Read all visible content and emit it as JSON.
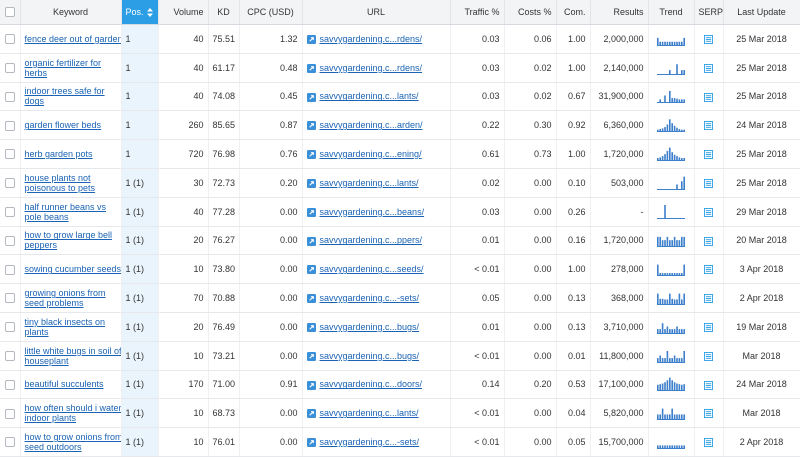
{
  "headers": {
    "keyword": "Keyword",
    "pos": "Pos.",
    "volume": "Volume",
    "kd": "KD",
    "cpc": "CPC (USD)",
    "url": "URL",
    "traffic": "Traffic %",
    "costs": "Costs %",
    "com": "Com.",
    "results": "Results",
    "trend": "Trend",
    "serp": "SERP",
    "last_update": "Last Update"
  },
  "rows": [
    {
      "keyword": "fence deer out of garden",
      "pos": "1",
      "volume": "40",
      "kd": "75.51",
      "cpc": "1.32",
      "url": "savvygardening.c...rdens/",
      "traffic": "0.03",
      "costs": "0.06",
      "com": "1.00",
      "results": "2,000,000",
      "last_update": "25 Mar 2018",
      "trend": [
        0.55,
        0.25,
        0.25,
        0.25,
        0.25,
        0.25,
        0.25,
        0.25,
        0.25,
        0.25,
        0.25,
        0.55
      ]
    },
    {
      "keyword": "organic fertilizer for herbs",
      "pos": "1",
      "volume": "40",
      "kd": "61.17",
      "cpc": "0.48",
      "url": "savvygardening.c...rdens/",
      "traffic": "0.03",
      "costs": "0.02",
      "com": "1.00",
      "results": "2,140,000",
      "last_update": "25 Mar 2018",
      "trend": [
        0,
        0,
        0,
        0,
        0,
        0.3,
        0,
        0,
        0.75,
        0,
        0.3,
        0.3
      ]
    },
    {
      "keyword": "indoor trees safe for dogs",
      "pos": "1",
      "volume": "40",
      "kd": "74.08",
      "cpc": "0.45",
      "url": "savvygardening.c...lants/",
      "traffic": "0.03",
      "costs": "0.02",
      "com": "0.67",
      "results": "31,900,000",
      "last_update": "25 Mar 2018",
      "trend": [
        0,
        0.2,
        0,
        0.5,
        0,
        0.85,
        0.3,
        0.3,
        0.25,
        0.2,
        0.2,
        0.2
      ]
    },
    {
      "keyword": "garden flower beds",
      "pos": "1",
      "volume": "260",
      "kd": "85.65",
      "cpc": "0.87",
      "url": "savvygardening.c...arden/",
      "traffic": "0.22",
      "costs": "0.30",
      "com": "0.92",
      "results": "6,360,000",
      "last_update": "24 Mar 2018",
      "trend": [
        0.1,
        0.15,
        0.2,
        0.3,
        0.5,
        0.9,
        0.6,
        0.4,
        0.25,
        0.15,
        0.1,
        0.1
      ]
    },
    {
      "keyword": "herb garden pots",
      "pos": "1",
      "volume": "720",
      "kd": "76.98",
      "cpc": "0.76",
      "url": "savvygardening.c...ening/",
      "traffic": "0.61",
      "costs": "0.73",
      "com": "1.00",
      "results": "1,720,000",
      "last_update": "25 Mar 2018",
      "trend": [
        0.15,
        0.2,
        0.3,
        0.45,
        0.7,
        0.95,
        0.6,
        0.4,
        0.3,
        0.2,
        0.15,
        0.15
      ]
    },
    {
      "keyword": "house plants not poisonous to pets",
      "pos": "1 (1)",
      "volume": "30",
      "kd": "72.73",
      "cpc": "0.20",
      "url": "savvygardening.c...lants/",
      "traffic": "0.02",
      "costs": "0.00",
      "com": "0.10",
      "results": "503,000",
      "last_update": "25 Mar 2018",
      "trend": [
        0,
        0,
        0,
        0,
        0,
        0,
        0,
        0,
        0.35,
        0,
        0.6,
        0.95
      ]
    },
    {
      "keyword": "half runner beans vs pole beans",
      "pos": "1 (1)",
      "volume": "40",
      "kd": "77.28",
      "cpc": "0.00",
      "url": "savvygardening.c...beans/",
      "traffic": "0.03",
      "costs": "0.00",
      "com": "0.26",
      "results": "-",
      "last_update": "29 Mar 2018",
      "trend": [
        0,
        0,
        0,
        1,
        0,
        0,
        0,
        0,
        0,
        0,
        0,
        0
      ]
    },
    {
      "keyword": "how to grow large bell peppers",
      "pos": "1 (1)",
      "volume": "20",
      "kd": "76.27",
      "cpc": "0.00",
      "url": "savvygardening.c...ppers/",
      "traffic": "0.01",
      "costs": "0.00",
      "com": "0.16",
      "results": "1,720,000",
      "last_update": "20 Mar 2018",
      "trend": [
        0.7,
        0.7,
        0.45,
        0.45,
        0.7,
        0.45,
        0.45,
        0.7,
        0.45,
        0.45,
        0.7,
        0.7
      ]
    },
    {
      "keyword": "sowing cucumber seeds",
      "pos": "1 (1)",
      "volume": "10",
      "kd": "73.80",
      "cpc": "0.00",
      "url": "savvygardening.c...seeds/",
      "traffic": "< 0.01",
      "costs": "0.00",
      "com": "1.00",
      "results": "278,000",
      "last_update": "3 Apr 2018",
      "trend": [
        0.8,
        0.15,
        0.15,
        0.15,
        0.15,
        0.15,
        0.15,
        0.15,
        0.15,
        0.15,
        0.15,
        0.8
      ]
    },
    {
      "keyword": "growing onions from seed problems",
      "pos": "1 (1)",
      "volume": "70",
      "kd": "70.88",
      "cpc": "0.00",
      "url": "savvygardening.c...-sets/",
      "traffic": "0.05",
      "costs": "0.00",
      "com": "0.13",
      "results": "368,000",
      "last_update": "2 Apr 2018",
      "trend": [
        0.8,
        0.4,
        0.4,
        0.35,
        0.35,
        0.8,
        0.4,
        0.35,
        0.35,
        0.8,
        0.35,
        0.8
      ]
    },
    {
      "keyword": "tiny black insects on plants",
      "pos": "1 (1)",
      "volume": "20",
      "kd": "76.49",
      "cpc": "0.00",
      "url": "savvygardening.c...bugs/",
      "traffic": "0.01",
      "costs": "0.00",
      "com": "0.13",
      "results": "3,710,000",
      "last_update": "19 Mar 2018",
      "trend": [
        0.3,
        0.3,
        0.75,
        0.3,
        0.5,
        0.3,
        0.3,
        0.3,
        0.5,
        0.3,
        0.3,
        0.3
      ]
    },
    {
      "keyword": "little white bugs in soil of houseplant",
      "pos": "1 (1)",
      "volume": "10",
      "kd": "73.21",
      "cpc": "0.00",
      "url": "savvygardening.c...bugs/",
      "traffic": "< 0.01",
      "costs": "0.00",
      "com": "0.01",
      "results": "11,800,000",
      "last_update": "Mar 2018",
      "trend": [
        0.3,
        0.5,
        0.3,
        0.3,
        0.85,
        0.3,
        0.3,
        0.5,
        0.3,
        0.3,
        0.3,
        0.85
      ]
    },
    {
      "keyword": "beautiful succulents",
      "pos": "1 (1)",
      "volume": "170",
      "kd": "71.00",
      "cpc": "0.91",
      "url": "savvygardening.c...doors/",
      "traffic": "0.14",
      "costs": "0.20",
      "com": "0.53",
      "results": "17,100,000",
      "last_update": "24 Mar 2018",
      "trend": [
        0.4,
        0.45,
        0.5,
        0.6,
        0.75,
        0.95,
        0.75,
        0.6,
        0.5,
        0.45,
        0.4,
        0.45
      ]
    },
    {
      "keyword": "how often should i water indoor plants",
      "pos": "1 (1)",
      "volume": "10",
      "kd": "68.73",
      "cpc": "0.00",
      "url": "savvygardening.c...lants/",
      "traffic": "< 0.01",
      "costs": "0.00",
      "com": "0.04",
      "results": "5,820,000",
      "last_update": "Mar 2018",
      "trend": [
        0.35,
        0.35,
        0.8,
        0.35,
        0.35,
        0.35,
        0.8,
        0.35,
        0.35,
        0.35,
        0.35,
        0.35
      ]
    },
    {
      "keyword": "how to grow onions from seed outdoors",
      "pos": "1 (1)",
      "volume": "10",
      "kd": "76.01",
      "cpc": "0.00",
      "url": "savvygardening.c...-sets/",
      "traffic": "< 0.01",
      "costs": "0.00",
      "com": "0.05",
      "results": "15,700,000",
      "last_update": "2 Apr 2018",
      "trend": [
        0.2,
        0.2,
        0.2,
        0.2,
        0.2,
        0.2,
        0.2,
        0.2,
        0.2,
        0.2,
        0.2,
        0.2
      ]
    }
  ],
  "icons": {
    "row_checkbox": "checkbox-icon",
    "header_checkbox": "checkbox-icon",
    "url_link": "external-link-icon",
    "sort": "sort-arrows-icon",
    "serp": "serp-page-icon",
    "trend": "trend-sparkline-icon"
  },
  "colors": {
    "link": "#1a63b5",
    "sorted_header_bg": "#2b9ee6",
    "pos_cell_bg": "#e9f4fc",
    "header_bg": "#f3f4f6",
    "trend_bar": "#3d7fcb",
    "serp_icon": "#2b9ee6"
  }
}
